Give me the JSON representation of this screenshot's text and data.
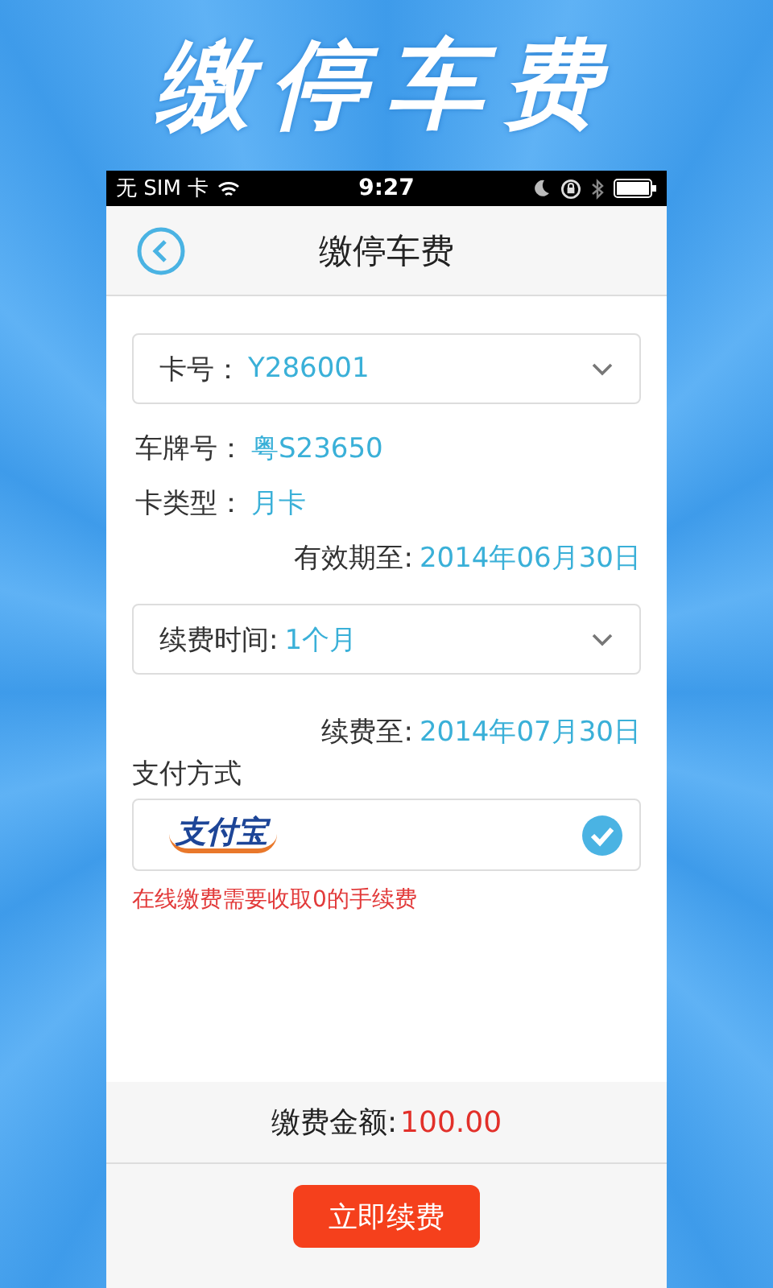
{
  "promo_title": "缴停车费",
  "status_bar": {
    "carrier": "无 SIM 卡",
    "time": "9:27"
  },
  "nav": {
    "title": "缴停车费"
  },
  "card_select": {
    "label": "卡号：",
    "value": "Y286001"
  },
  "info_rows": [
    {
      "label": "车牌号：",
      "value": "粤S23650"
    },
    {
      "label": "卡类型：",
      "value": "月卡"
    }
  ],
  "valid_until": {
    "label": "有效期至:",
    "value": "2014年06月30日"
  },
  "renew_select": {
    "label": "续费时间:",
    "value": "1个月"
  },
  "renew_until": {
    "label": "续费至:",
    "value": "2014年07月30日"
  },
  "payment": {
    "heading": "支付方式",
    "options": [
      {
        "name": "支付宝",
        "selected": true
      }
    ],
    "note": "在线缴费需要收取0的手续费"
  },
  "amount": {
    "label": "缴费金额:",
    "value": "100.00"
  },
  "submit": "立即续费"
}
